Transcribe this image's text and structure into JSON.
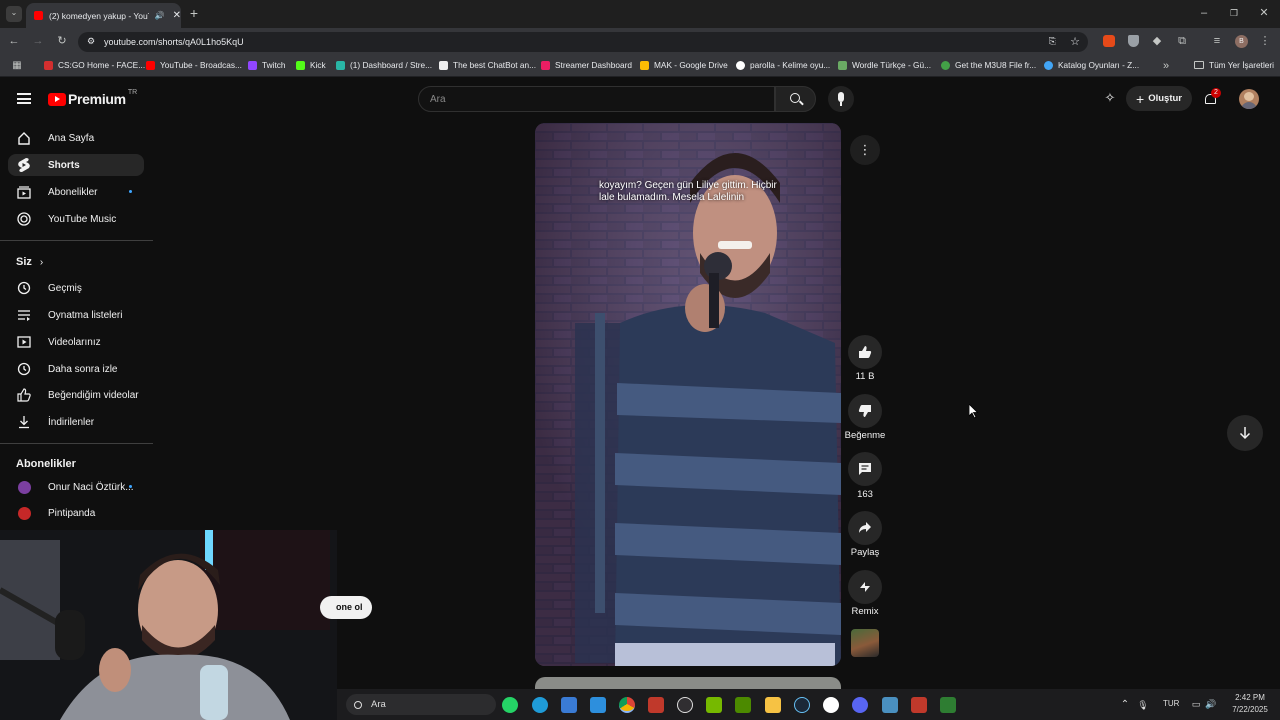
{
  "browser": {
    "tab_title": "(2) komedyen yakup - YouT",
    "url": "youtube.com/shorts/qA0L1ho5KqU",
    "bookmarks": [
      {
        "label": "CS:GO Home - FACE...",
        "color": "#d32f2f"
      },
      {
        "label": "YouTube - Broadcas...",
        "color": "#ff0000"
      },
      {
        "label": "Twitch",
        "color": "#9146ff"
      },
      {
        "label": "Kick",
        "color": "#53fc18"
      },
      {
        "label": "(1) Dashboard / Stre...",
        "color": "#29b6a6"
      },
      {
        "label": "The best ChatBot an...",
        "color": "#eeeeee"
      },
      {
        "label": "Streamer Dashboard",
        "color": "#e91e63"
      },
      {
        "label": "MAK - Google Drive",
        "color": "#fbbc04"
      },
      {
        "label": "parolla - Kelime oyu...",
        "color": "#ffffff"
      },
      {
        "label": "Wordle Türkçe - Gü...",
        "color": "#6aaa64"
      },
      {
        "label": "Get the M3U8 File fr...",
        "color": "#43a047"
      },
      {
        "label": "Katalog Oyunları - Z...",
        "color": "#42a5f5"
      }
    ],
    "all_bookmarks": "Tüm Yer İşaretleri"
  },
  "youtube": {
    "logo_text": "Premium",
    "logo_region": "TR",
    "search_placeholder": "Ara",
    "create_label": "Oluştur",
    "notification_count": "2",
    "sidebar": {
      "items": [
        {
          "label": "Ana Sayfa",
          "icon": "home-icon"
        },
        {
          "label": "Shorts",
          "icon": "shorts-icon",
          "active": true
        },
        {
          "label": "Abonelikler",
          "icon": "subscriptions-icon",
          "dot": true
        },
        {
          "label": "YouTube Music",
          "icon": "music-icon"
        }
      ],
      "you_heading": "Siz",
      "you_items": [
        {
          "label": "Geçmiş",
          "icon": "history-icon"
        },
        {
          "label": "Oynatma listeleri",
          "icon": "playlists-icon"
        },
        {
          "label": "Videolarınız",
          "icon": "your-videos-icon"
        },
        {
          "label": "Daha sonra izle",
          "icon": "watch-later-icon"
        },
        {
          "label": "Beğendiğim videolar",
          "icon": "liked-icon"
        },
        {
          "label": "İndirilenler",
          "icon": "downloads-icon"
        }
      ],
      "subs_heading": "Abonelikler",
      "subs": [
        {
          "label": "Onur Naci Öztürk...",
          "color": "#7b3fa0"
        },
        {
          "label": "Pintipanda",
          "color": "#c62828"
        }
      ]
    },
    "short": {
      "caption": "koyayım? Geçen gün Liliye gittim. Hiçbir lale bulamadım. Mesela Lalelinin",
      "likes": "11 B",
      "dislike_label": "Beğenme",
      "comments": "163",
      "share_label": "Paylaş",
      "remix_label": "Remix"
    },
    "subscribe_partial": "one ol"
  },
  "taskbar": {
    "search_label": "Ara",
    "lang": "TUR",
    "time": "2:42 PM",
    "date": "7/22/2025"
  }
}
